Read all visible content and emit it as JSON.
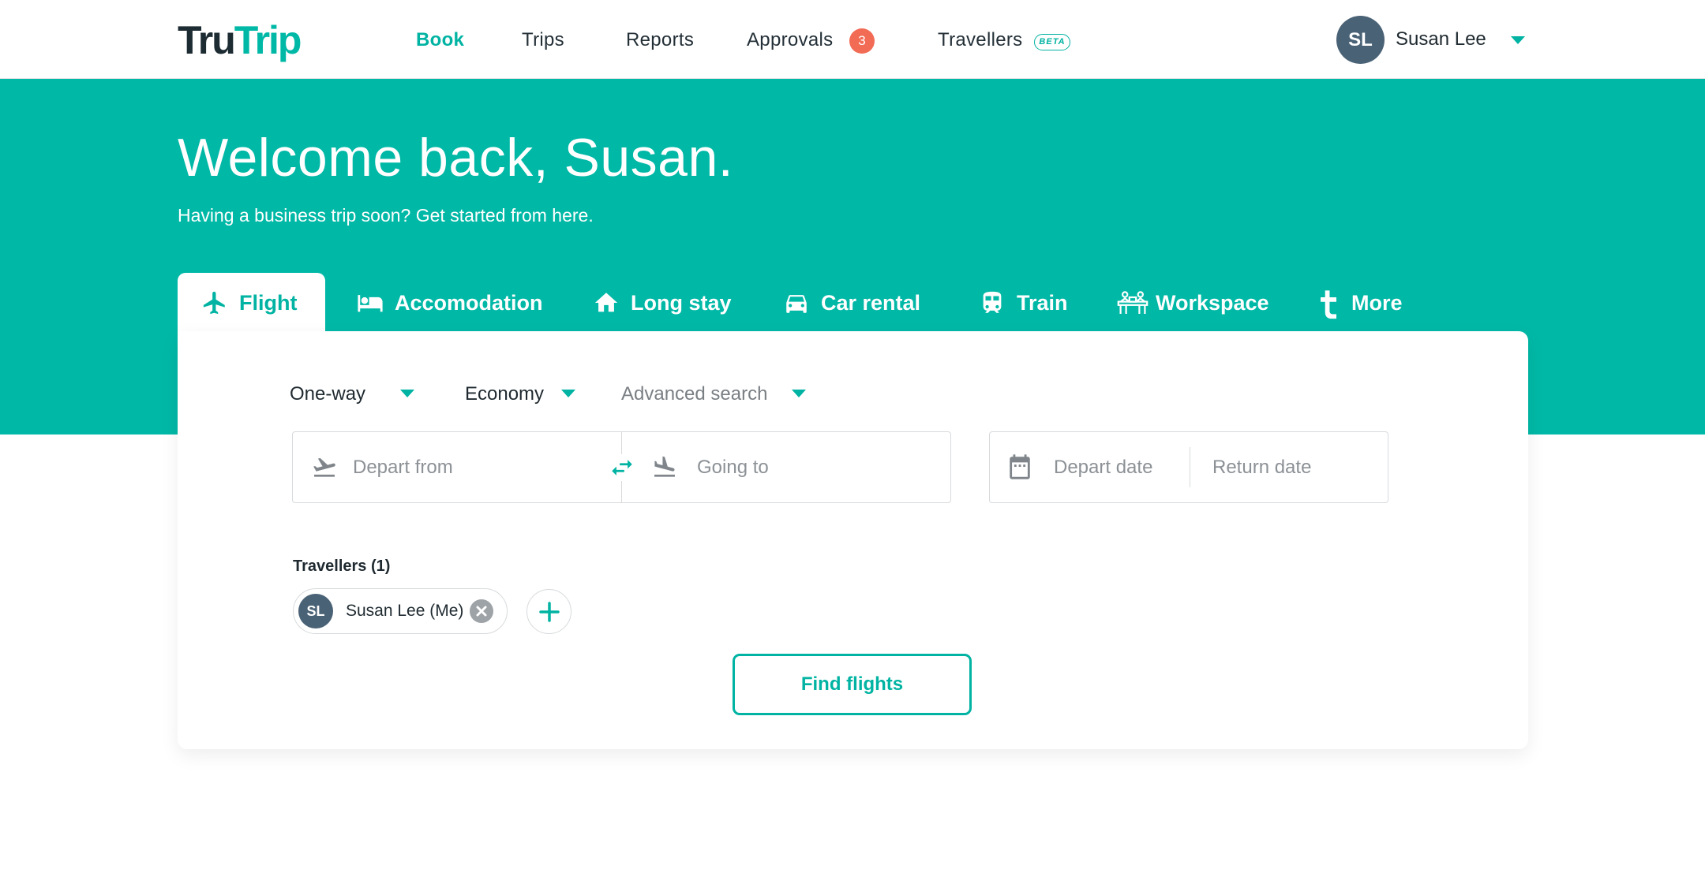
{
  "brand": {
    "logo_part1": "Tru",
    "logo_part2": "Trip"
  },
  "nav": {
    "book": "Book",
    "trips": "Trips",
    "reports": "Reports",
    "approvals": "Approvals",
    "approvals_count": "3",
    "travellers": "Travellers",
    "travellers_badge": "BETA"
  },
  "user": {
    "initials": "SL",
    "name": "Susan Lee"
  },
  "hero": {
    "title": "Welcome back, Susan.",
    "subtitle": "Having a business trip soon? Get started from here."
  },
  "tabs": [
    {
      "label": "Flight",
      "icon": "plane-icon",
      "active": true
    },
    {
      "label": "Accomodation",
      "icon": "bed-icon"
    },
    {
      "label": "Long stay",
      "icon": "home-icon"
    },
    {
      "label": "Car rental",
      "icon": "car-icon"
    },
    {
      "label": "Train",
      "icon": "train-icon"
    },
    {
      "label": "Workspace",
      "icon": "workspace-icon"
    },
    {
      "label": "More",
      "icon": "trutrip-t-icon"
    }
  ],
  "search": {
    "trip_type": "One-way",
    "cabin_class": "Economy",
    "advanced": "Advanced search",
    "depart_from_placeholder": "Depart from",
    "going_to_placeholder": "Going to",
    "depart_date_placeholder": "Depart date",
    "return_date_placeholder": "Return date"
  },
  "travellers": {
    "label": "Travellers (1)",
    "items": [
      {
        "initials": "SL",
        "name": "Susan Lee (Me)"
      }
    ]
  },
  "actions": {
    "find": "Find flights"
  },
  "colors": {
    "accent": "#00b8a6",
    "badge": "#f26b55",
    "avatar": "#4a6276"
  }
}
